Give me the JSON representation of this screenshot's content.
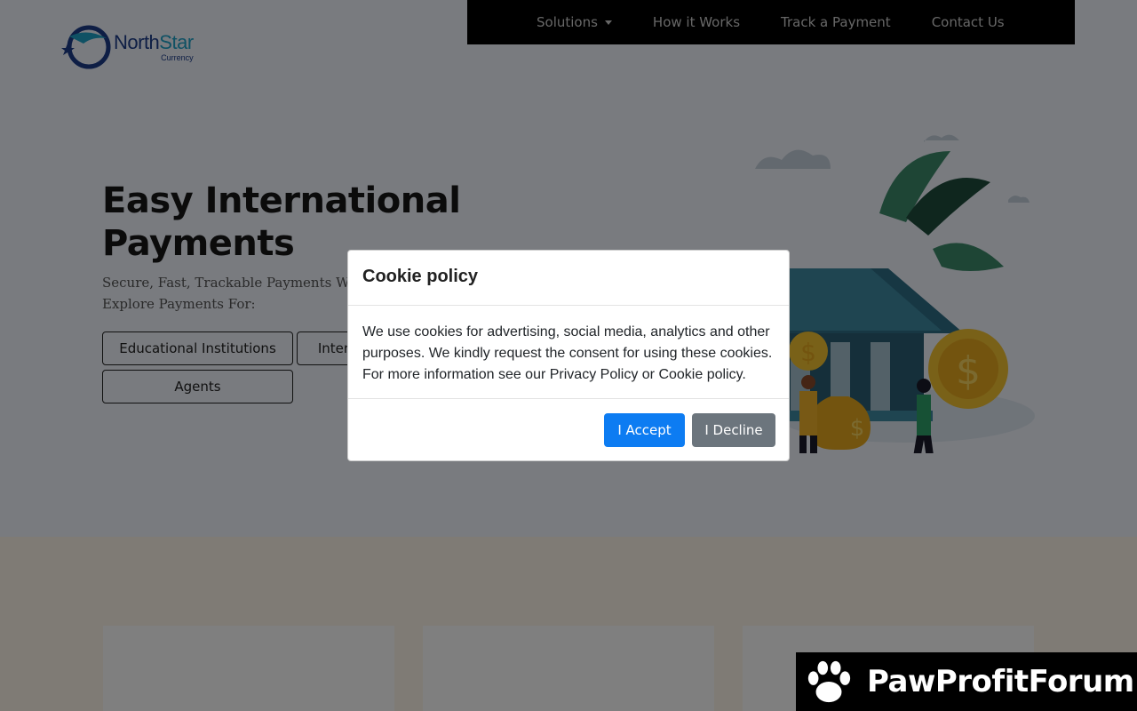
{
  "brand": {
    "name_part1": "North",
    "name_part2": "Star",
    "subtitle": "Currency"
  },
  "nav": {
    "items": [
      {
        "label": "Solutions",
        "has_dropdown": true
      },
      {
        "label": "How it Works"
      },
      {
        "label": "Track a Payment"
      },
      {
        "label": "Contact Us"
      }
    ]
  },
  "hero": {
    "title": "Easy International Payments",
    "subtitle_line1": "Secure, Fast, Trackable Payments Worldwide",
    "subtitle_line2": "Explore Payments For:",
    "buttons": [
      "Educational Institutions",
      "International Students",
      "Agents"
    ]
  },
  "cookie_modal": {
    "title": "Cookie policy",
    "body": "We use cookies for advertising, social media, analytics and other purposes. We kindly request the consent for using these cookies. For more information see our Privacy Policy or Cookie policy.",
    "accept_label": "I Accept",
    "decline_label": "I Decline"
  },
  "watermark": {
    "text": "PawProfitForum"
  },
  "colors": {
    "accent": "#0d7cf2",
    "decline": "#6c757d",
    "nav_bg": "#000000",
    "brand_blue": "#1c3d8a",
    "brand_cyan": "#1ea2c9"
  }
}
